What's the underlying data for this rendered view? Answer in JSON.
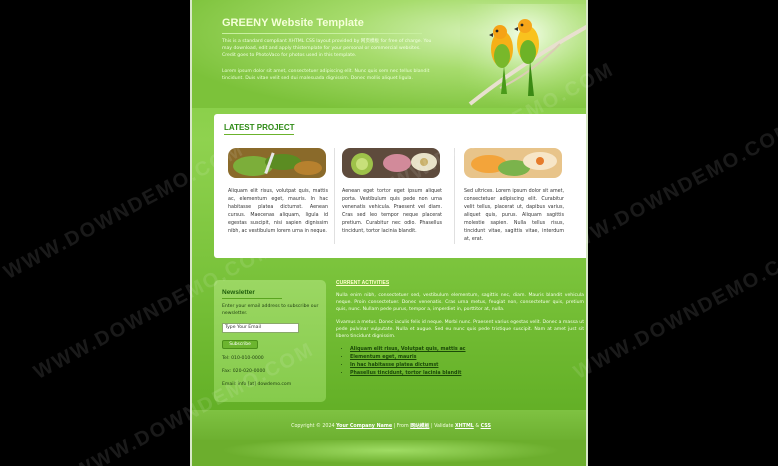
{
  "header": {
    "title": "GREENY Website Template",
    "intro": "This is a standard compliant XHTML CSS layout provided by 网页模板 for free of charge. You may download, edit and apply thistemplate for your personal or commercial websites. Credit goes to PhotoVaco for photos used in this template.",
    "intro2": "Lorem ipsum dolor sit amet, consectetuer adipiscing elit. Nunc quis sem nec tellus blandit tincidunt. Duis vitae velit sed dui malesuada dignissim. Donec mollis aliquet ligula."
  },
  "projects": {
    "title": "LATEST PROJECT",
    "items": [
      {
        "text": "Aliquam elit risus, volutpat quis, mattis ac, elementum eget, mauris. In hac habitasse platea dictumst. Aenean cursus. Maecenas aliquam, ligula id egestas suscipit, nisi sapien dignissim nibh, ac vestibulum lorem urna in neque."
      },
      {
        "text": "Aenean eget tortor eget ipsum aliquet porta. Vestibulum quis pede non urna venenatis vehicula. Praesent vel diam. Cras sed leo tempor neque placerat pretium. Curabitur nec odio. Phasellus tincidunt, tortor lacinia blandit."
      },
      {
        "text": "Sed ultrices. Lorem ipsum dolor sit amet, consectetuer adipiscing elit. Curabitur velit tellus, placerat ut, dapibus varius, aliquet quis, purus. Aliquam sagittis molestie sapien. Nulla tellus risus, tincidunt vitae, sagittis vitae, interdum at, erat."
      }
    ]
  },
  "newsletter": {
    "title": "Newsletter",
    "desc": "Enter your email address to subscribe our newsletter.",
    "input_value": "Type Your Email",
    "button": "Subscribe",
    "tel": "Tel: 010-010-0000",
    "fax": "Fax: 020-020-0000",
    "email": "Email: info [at] dowdemo.com"
  },
  "current": {
    "title": "CURRENT ACTIVITIES",
    "p1": "Nulla enim nibh, consectetuer sed, vestibulum elementum, sagittis nec, diam. Mauris blandit vehicula neque. Proin consectetuer. Donec venenatis. Cras urna metus, feugiat non, consectetuer quis, pretium quis, nunc. Nullam pede purus, tempor a, imperdiet in, porttitor at, nulla.",
    "p2": "Vivamus a metus. Donec iaculis felis id neque. Morbi nunc. Praesent varius egestas velit. Donec a massa ut pede pulvinar vulputate. Nulla et augue. Sed eu nunc quis pede tristique suscipit. Nam at amet just sit libero tincidunt dignissim.",
    "links": [
      "Aliquam elit risus, Volutpat quis, mattis ac",
      "Elementum eget, mauris",
      "In hac habitasse platea dictumst",
      "Phasellus tincidunt, tortor lacinia blandit"
    ]
  },
  "footer": {
    "prefix": "Copyright © 2024",
    "company": "Your Company Name",
    "mid": "| From",
    "mid_link": "网站模板",
    "valid": "| Validate",
    "xhtml": "XHTML",
    "amp": "&",
    "css": "CSS"
  },
  "watermark": "WWW.DOWNDEMO.COM",
  "colors": {
    "background": "#000000",
    "green_main": "#7cc83c",
    "green_dark": "#2e8a16",
    "white_box": "#ffffff"
  }
}
